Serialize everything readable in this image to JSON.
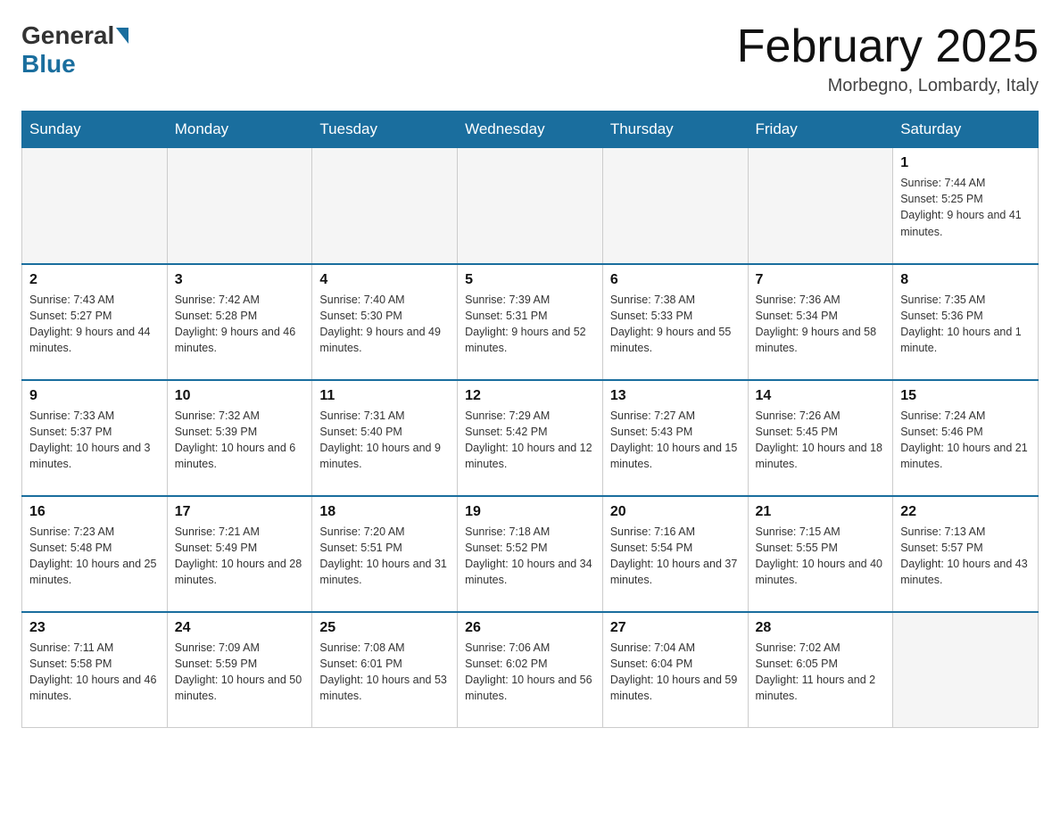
{
  "header": {
    "logo_general": "General",
    "logo_blue": "Blue",
    "month_title": "February 2025",
    "location": "Morbegno, Lombardy, Italy"
  },
  "days_of_week": [
    "Sunday",
    "Monday",
    "Tuesday",
    "Wednesday",
    "Thursday",
    "Friday",
    "Saturday"
  ],
  "weeks": [
    [
      {
        "num": "",
        "info": ""
      },
      {
        "num": "",
        "info": ""
      },
      {
        "num": "",
        "info": ""
      },
      {
        "num": "",
        "info": ""
      },
      {
        "num": "",
        "info": ""
      },
      {
        "num": "",
        "info": ""
      },
      {
        "num": "1",
        "info": "Sunrise: 7:44 AM\nSunset: 5:25 PM\nDaylight: 9 hours and 41 minutes."
      }
    ],
    [
      {
        "num": "2",
        "info": "Sunrise: 7:43 AM\nSunset: 5:27 PM\nDaylight: 9 hours and 44 minutes."
      },
      {
        "num": "3",
        "info": "Sunrise: 7:42 AM\nSunset: 5:28 PM\nDaylight: 9 hours and 46 minutes."
      },
      {
        "num": "4",
        "info": "Sunrise: 7:40 AM\nSunset: 5:30 PM\nDaylight: 9 hours and 49 minutes."
      },
      {
        "num": "5",
        "info": "Sunrise: 7:39 AM\nSunset: 5:31 PM\nDaylight: 9 hours and 52 minutes."
      },
      {
        "num": "6",
        "info": "Sunrise: 7:38 AM\nSunset: 5:33 PM\nDaylight: 9 hours and 55 minutes."
      },
      {
        "num": "7",
        "info": "Sunrise: 7:36 AM\nSunset: 5:34 PM\nDaylight: 9 hours and 58 minutes."
      },
      {
        "num": "8",
        "info": "Sunrise: 7:35 AM\nSunset: 5:36 PM\nDaylight: 10 hours and 1 minute."
      }
    ],
    [
      {
        "num": "9",
        "info": "Sunrise: 7:33 AM\nSunset: 5:37 PM\nDaylight: 10 hours and 3 minutes."
      },
      {
        "num": "10",
        "info": "Sunrise: 7:32 AM\nSunset: 5:39 PM\nDaylight: 10 hours and 6 minutes."
      },
      {
        "num": "11",
        "info": "Sunrise: 7:31 AM\nSunset: 5:40 PM\nDaylight: 10 hours and 9 minutes."
      },
      {
        "num": "12",
        "info": "Sunrise: 7:29 AM\nSunset: 5:42 PM\nDaylight: 10 hours and 12 minutes."
      },
      {
        "num": "13",
        "info": "Sunrise: 7:27 AM\nSunset: 5:43 PM\nDaylight: 10 hours and 15 minutes."
      },
      {
        "num": "14",
        "info": "Sunrise: 7:26 AM\nSunset: 5:45 PM\nDaylight: 10 hours and 18 minutes."
      },
      {
        "num": "15",
        "info": "Sunrise: 7:24 AM\nSunset: 5:46 PM\nDaylight: 10 hours and 21 minutes."
      }
    ],
    [
      {
        "num": "16",
        "info": "Sunrise: 7:23 AM\nSunset: 5:48 PM\nDaylight: 10 hours and 25 minutes."
      },
      {
        "num": "17",
        "info": "Sunrise: 7:21 AM\nSunset: 5:49 PM\nDaylight: 10 hours and 28 minutes."
      },
      {
        "num": "18",
        "info": "Sunrise: 7:20 AM\nSunset: 5:51 PM\nDaylight: 10 hours and 31 minutes."
      },
      {
        "num": "19",
        "info": "Sunrise: 7:18 AM\nSunset: 5:52 PM\nDaylight: 10 hours and 34 minutes."
      },
      {
        "num": "20",
        "info": "Sunrise: 7:16 AM\nSunset: 5:54 PM\nDaylight: 10 hours and 37 minutes."
      },
      {
        "num": "21",
        "info": "Sunrise: 7:15 AM\nSunset: 5:55 PM\nDaylight: 10 hours and 40 minutes."
      },
      {
        "num": "22",
        "info": "Sunrise: 7:13 AM\nSunset: 5:57 PM\nDaylight: 10 hours and 43 minutes."
      }
    ],
    [
      {
        "num": "23",
        "info": "Sunrise: 7:11 AM\nSunset: 5:58 PM\nDaylight: 10 hours and 46 minutes."
      },
      {
        "num": "24",
        "info": "Sunrise: 7:09 AM\nSunset: 5:59 PM\nDaylight: 10 hours and 50 minutes."
      },
      {
        "num": "25",
        "info": "Sunrise: 7:08 AM\nSunset: 6:01 PM\nDaylight: 10 hours and 53 minutes."
      },
      {
        "num": "26",
        "info": "Sunrise: 7:06 AM\nSunset: 6:02 PM\nDaylight: 10 hours and 56 minutes."
      },
      {
        "num": "27",
        "info": "Sunrise: 7:04 AM\nSunset: 6:04 PM\nDaylight: 10 hours and 59 minutes."
      },
      {
        "num": "28",
        "info": "Sunrise: 7:02 AM\nSunset: 6:05 PM\nDaylight: 11 hours and 2 minutes."
      },
      {
        "num": "",
        "info": ""
      }
    ]
  ]
}
